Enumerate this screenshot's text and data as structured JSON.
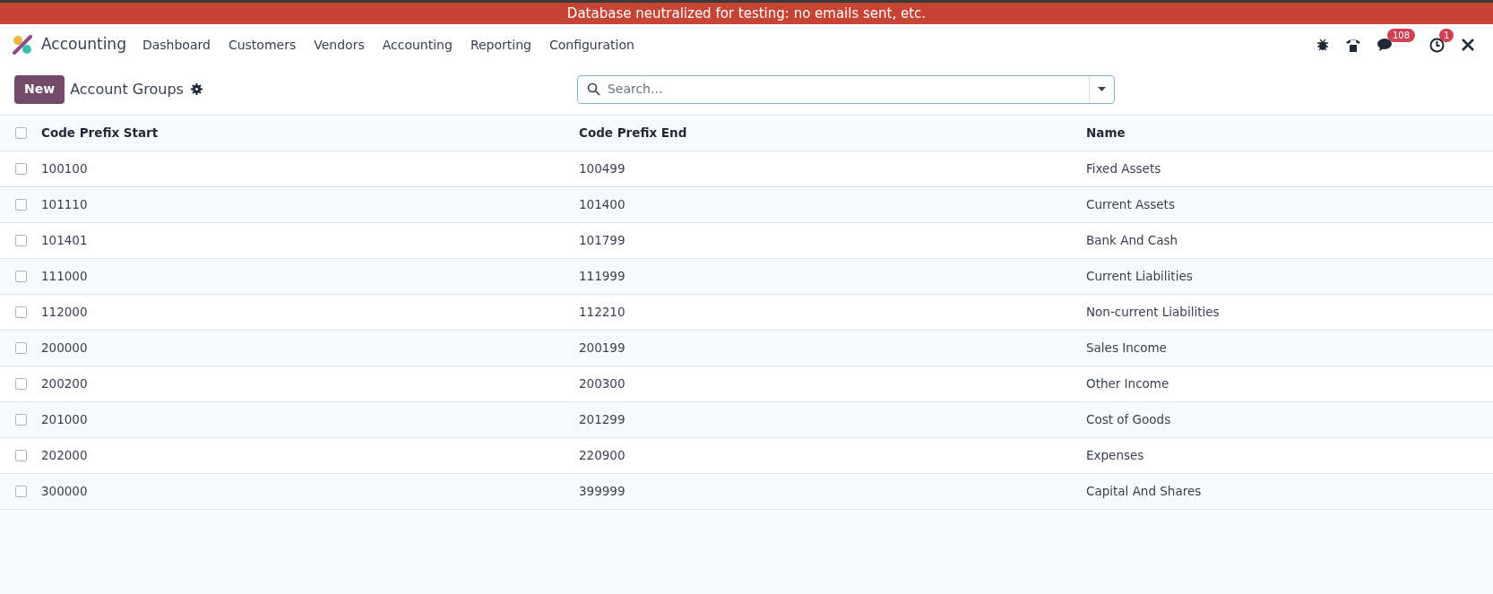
{
  "banner": "Database neutralized for testing: no emails sent, etc.",
  "navbar": {
    "app": "Accounting",
    "menu": [
      "Dashboard",
      "Customers",
      "Vendors",
      "Accounting",
      "Reporting",
      "Configuration"
    ],
    "messages_badge": "108",
    "activities_badge": "1"
  },
  "control_panel": {
    "new_button": "New",
    "title": "Account Groups",
    "search": {
      "placeholder": "Search..."
    }
  },
  "table": {
    "all_checked": false,
    "columns": [
      "Code Prefix Start",
      "Code Prefix End",
      "Name"
    ],
    "rows": [
      {
        "checked": false,
        "cells": [
          "100100",
          "100499",
          "Fixed Assets"
        ]
      },
      {
        "checked": false,
        "cells": [
          "101110",
          "101400",
          "Current Assets"
        ]
      },
      {
        "checked": false,
        "cells": [
          "101401",
          "101799",
          "Bank And Cash"
        ]
      },
      {
        "checked": false,
        "cells": [
          "111000",
          "111999",
          "Current Liabilities"
        ]
      },
      {
        "checked": false,
        "cells": [
          "112000",
          "112210",
          "Non-current Liabilities"
        ]
      },
      {
        "checked": false,
        "cells": [
          "200000",
          "200199",
          "Sales Income"
        ]
      },
      {
        "checked": false,
        "cells": [
          "200200",
          "200300",
          "Other Income"
        ]
      },
      {
        "checked": false,
        "cells": [
          "201000",
          "201299",
          "Cost of Goods"
        ]
      },
      {
        "checked": false,
        "cells": [
          "202000",
          "220900",
          "Expenses"
        ]
      },
      {
        "checked": false,
        "cells": [
          "300000",
          "399999",
          "Capital And Shares"
        ]
      }
    ]
  }
}
